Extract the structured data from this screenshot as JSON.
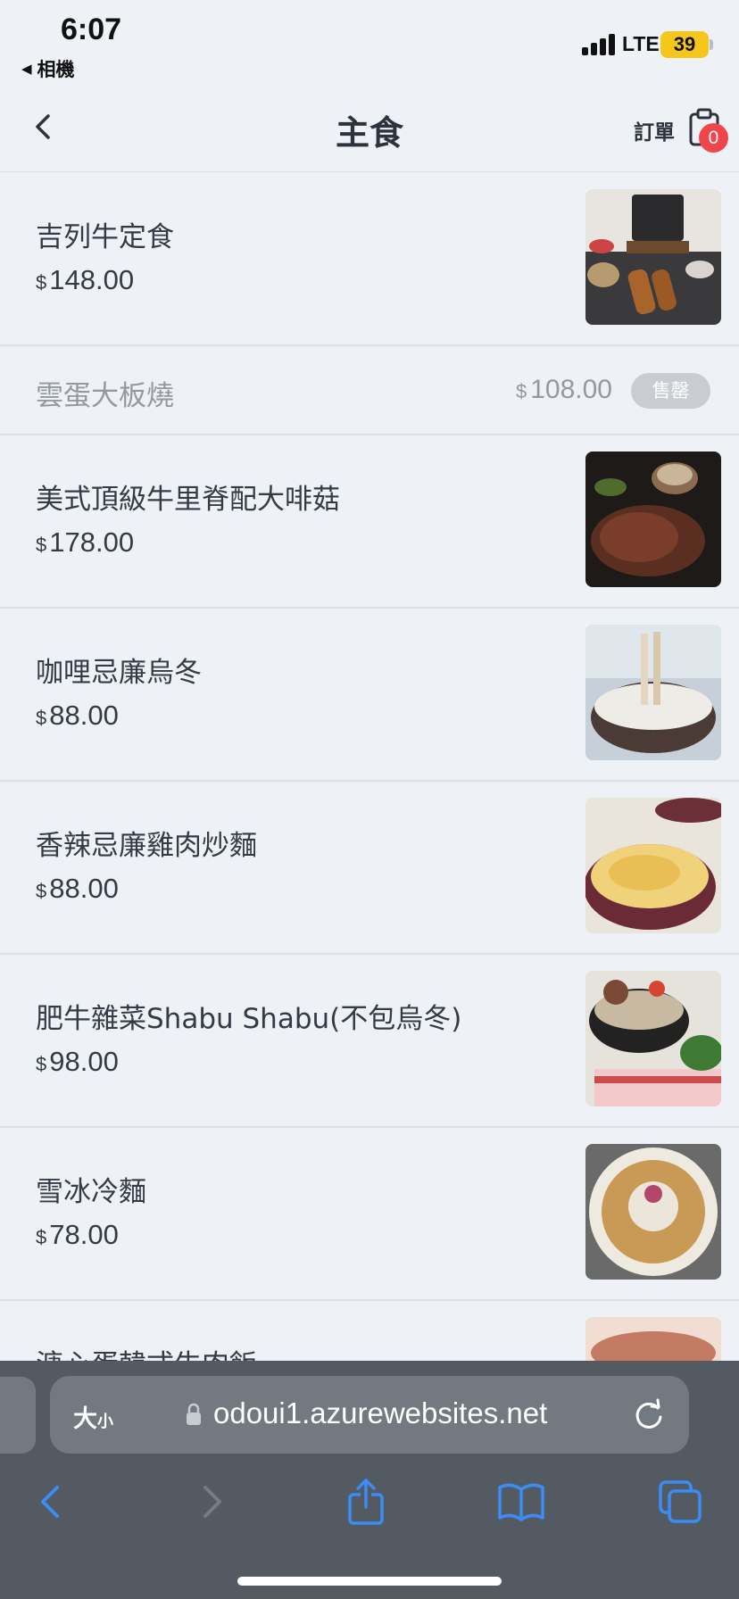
{
  "status": {
    "time": "6:07",
    "back_app": "相機",
    "network": "LTE",
    "battery": "39"
  },
  "header": {
    "title": "主食",
    "order_label": "訂單",
    "order_count": "0"
  },
  "currency": "$",
  "items": [
    {
      "name": "吉列牛定食",
      "price": "148.00",
      "image": "tonkatsu-set-image"
    },
    {
      "name": "雲蛋大板燒",
      "price": "108.00",
      "sold_out": true,
      "badge": "售罄"
    },
    {
      "name": "美式頂級牛里脊配大啡菇",
      "price": "178.00",
      "image": "steak-image"
    },
    {
      "name": "咖哩忌廉烏冬",
      "price": "88.00",
      "image": "curry-udon-image"
    },
    {
      "name": "香辣忌廉雞肉炒麵",
      "price": "88.00",
      "image": "fried-noodle-image"
    },
    {
      "name": "肥牛雜菜Shabu Shabu(不包烏冬)",
      "price": "98.00",
      "image": "shabu-image"
    },
    {
      "name": "雪冰冷麵",
      "price": "78.00",
      "image": "cold-noodle-image"
    },
    {
      "name": "溏心蛋韓式牛肉飯",
      "price": "",
      "image": "beef-rice-image"
    }
  ],
  "browser": {
    "text_size_label": "大",
    "text_size_small": "小",
    "url": "odoui1.azurewebsites.net"
  },
  "colors": {
    "background": "#eef1f5",
    "badge_red": "#f0464b",
    "safari_bar": "#545a62",
    "link_blue": "#3b8cf4"
  }
}
